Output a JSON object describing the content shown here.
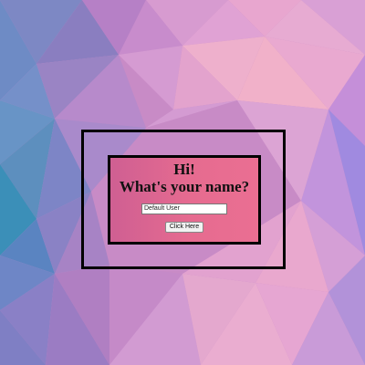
{
  "dialog": {
    "greeting": "Hi!",
    "question": "What's your name?",
    "name_input": {
      "value": "Default User"
    },
    "button_label": "Click Here"
  },
  "colors": {
    "dialog_bg": "#e66b90",
    "frame_border": "#000000"
  }
}
